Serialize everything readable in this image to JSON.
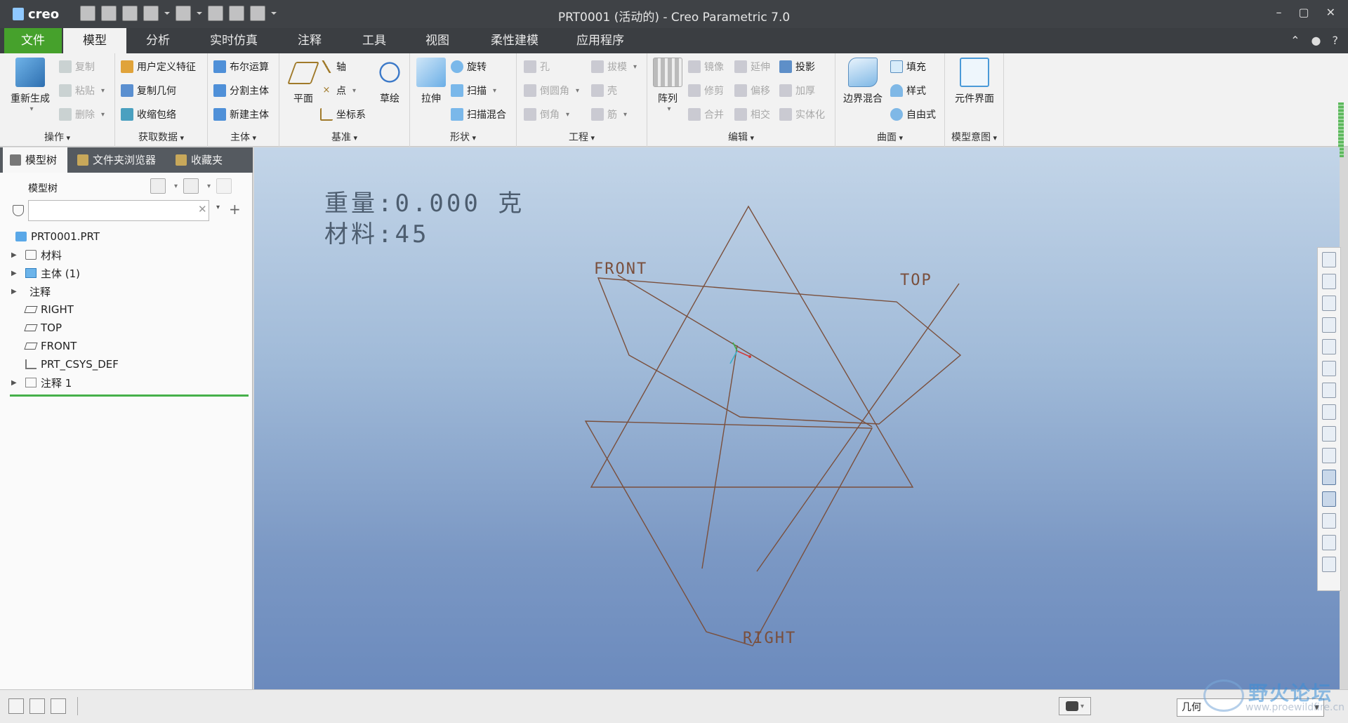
{
  "window": {
    "app_logo": "creo",
    "title": "PRT0001 (活动的) - Creo Parametric 7.0",
    "controls": [
      "–",
      "▢",
      "✕"
    ]
  },
  "quick_access": [
    "new-icon",
    "open-icon",
    "save-icon",
    "undo-icon",
    "redo-icon",
    "regenerate-icon",
    "windows-icon",
    "close-window-icon"
  ],
  "tabs": [
    {
      "label": "文件"
    },
    {
      "label": "模型"
    },
    {
      "label": "分析"
    },
    {
      "label": "实时仿真"
    },
    {
      "label": "注释"
    },
    {
      "label": "工具"
    },
    {
      "label": "视图"
    },
    {
      "label": "柔性建模"
    },
    {
      "label": "应用程序"
    }
  ],
  "ribbon": {
    "operations": {
      "label": "操作",
      "regenerate": "重新生成",
      "copy": "复制",
      "paste": "粘贴",
      "delete": "删除"
    },
    "get_data": {
      "label": "获取数据",
      "udf": "用户定义特征",
      "copy_geometry": "复制几何",
      "shrinkwrap": "收缩包络"
    },
    "body": {
      "label": "主体",
      "boolean": "布尔运算",
      "split_body": "分割主体",
      "new_body": "新建主体"
    },
    "datum": {
      "label": "基准",
      "plane": "平面",
      "axis": "轴",
      "point": "点",
      "csys": "坐标系",
      "sketch": "草绘"
    },
    "shapes": {
      "label": "形状",
      "extrude": "拉伸",
      "revolve": "旋转",
      "sweep": "扫描",
      "swept_blend": "扫描混合"
    },
    "engineering": {
      "label": "工程",
      "hole": "孔",
      "draft": "拔模",
      "round": "倒圆角",
      "shell": "壳",
      "chamfer": "倒角",
      "rib": "筋"
    },
    "editing": {
      "label": "编辑",
      "pattern": "阵列",
      "mirror": "镜像",
      "extend": "延伸",
      "project": "投影",
      "trim": "修剪",
      "offset": "偏移",
      "thicken": "加厚",
      "merge": "合并",
      "intersect": "相交",
      "solidify": "实体化"
    },
    "surfaces": {
      "label": "曲面",
      "boundary_blend": "边界混合",
      "fill": "填充",
      "style": "样式",
      "freestyle": "自由式"
    },
    "model_intent": {
      "label": "模型意图",
      "component_interface": "元件界面"
    }
  },
  "left_panel": {
    "tabs": [
      "模型树",
      "文件夹浏览器",
      "收藏夹"
    ],
    "tree_header": "模型树",
    "search_placeholder": "",
    "tree": [
      {
        "label": "PRT0001.PRT",
        "icon": "part-icon",
        "expandable": false,
        "indent": 0
      },
      {
        "label": "材料",
        "icon": "material-icon",
        "expandable": true,
        "indent": 1
      },
      {
        "label": "主体 (1)",
        "icon": "body-icon",
        "expandable": true,
        "indent": 1
      },
      {
        "label": "注释",
        "icon": "",
        "expandable": true,
        "indent": 1
      },
      {
        "label": "RIGHT",
        "icon": "datum-plane-icon",
        "expandable": false,
        "indent": 1
      },
      {
        "label": "TOP",
        "icon": "datum-plane-icon",
        "expandable": false,
        "indent": 1
      },
      {
        "label": "FRONT",
        "icon": "datum-plane-icon",
        "expandable": false,
        "indent": 1
      },
      {
        "label": "PRT_CSYS_DEF",
        "icon": "csys-icon",
        "expandable": false,
        "indent": 1
      },
      {
        "label": "注释 1",
        "icon": "note-icon",
        "expandable": true,
        "indent": 1
      }
    ]
  },
  "viewport": {
    "mass_line": "重量:0.000 克",
    "material_line": "材料:45",
    "plane_labels": {
      "front": "FRONT",
      "top": "TOP",
      "right": "RIGHT"
    }
  },
  "status_bar": {
    "selection_filter": "几何"
  },
  "watermark": {
    "title": "野火论坛",
    "url": "www.proewildfire.cn"
  },
  "colors": {
    "file_tab": "#46a12c",
    "plane_lines": "#7a4f3c",
    "viewport_top": "#c3d5e8",
    "viewport_bottom": "#6b8abd"
  }
}
